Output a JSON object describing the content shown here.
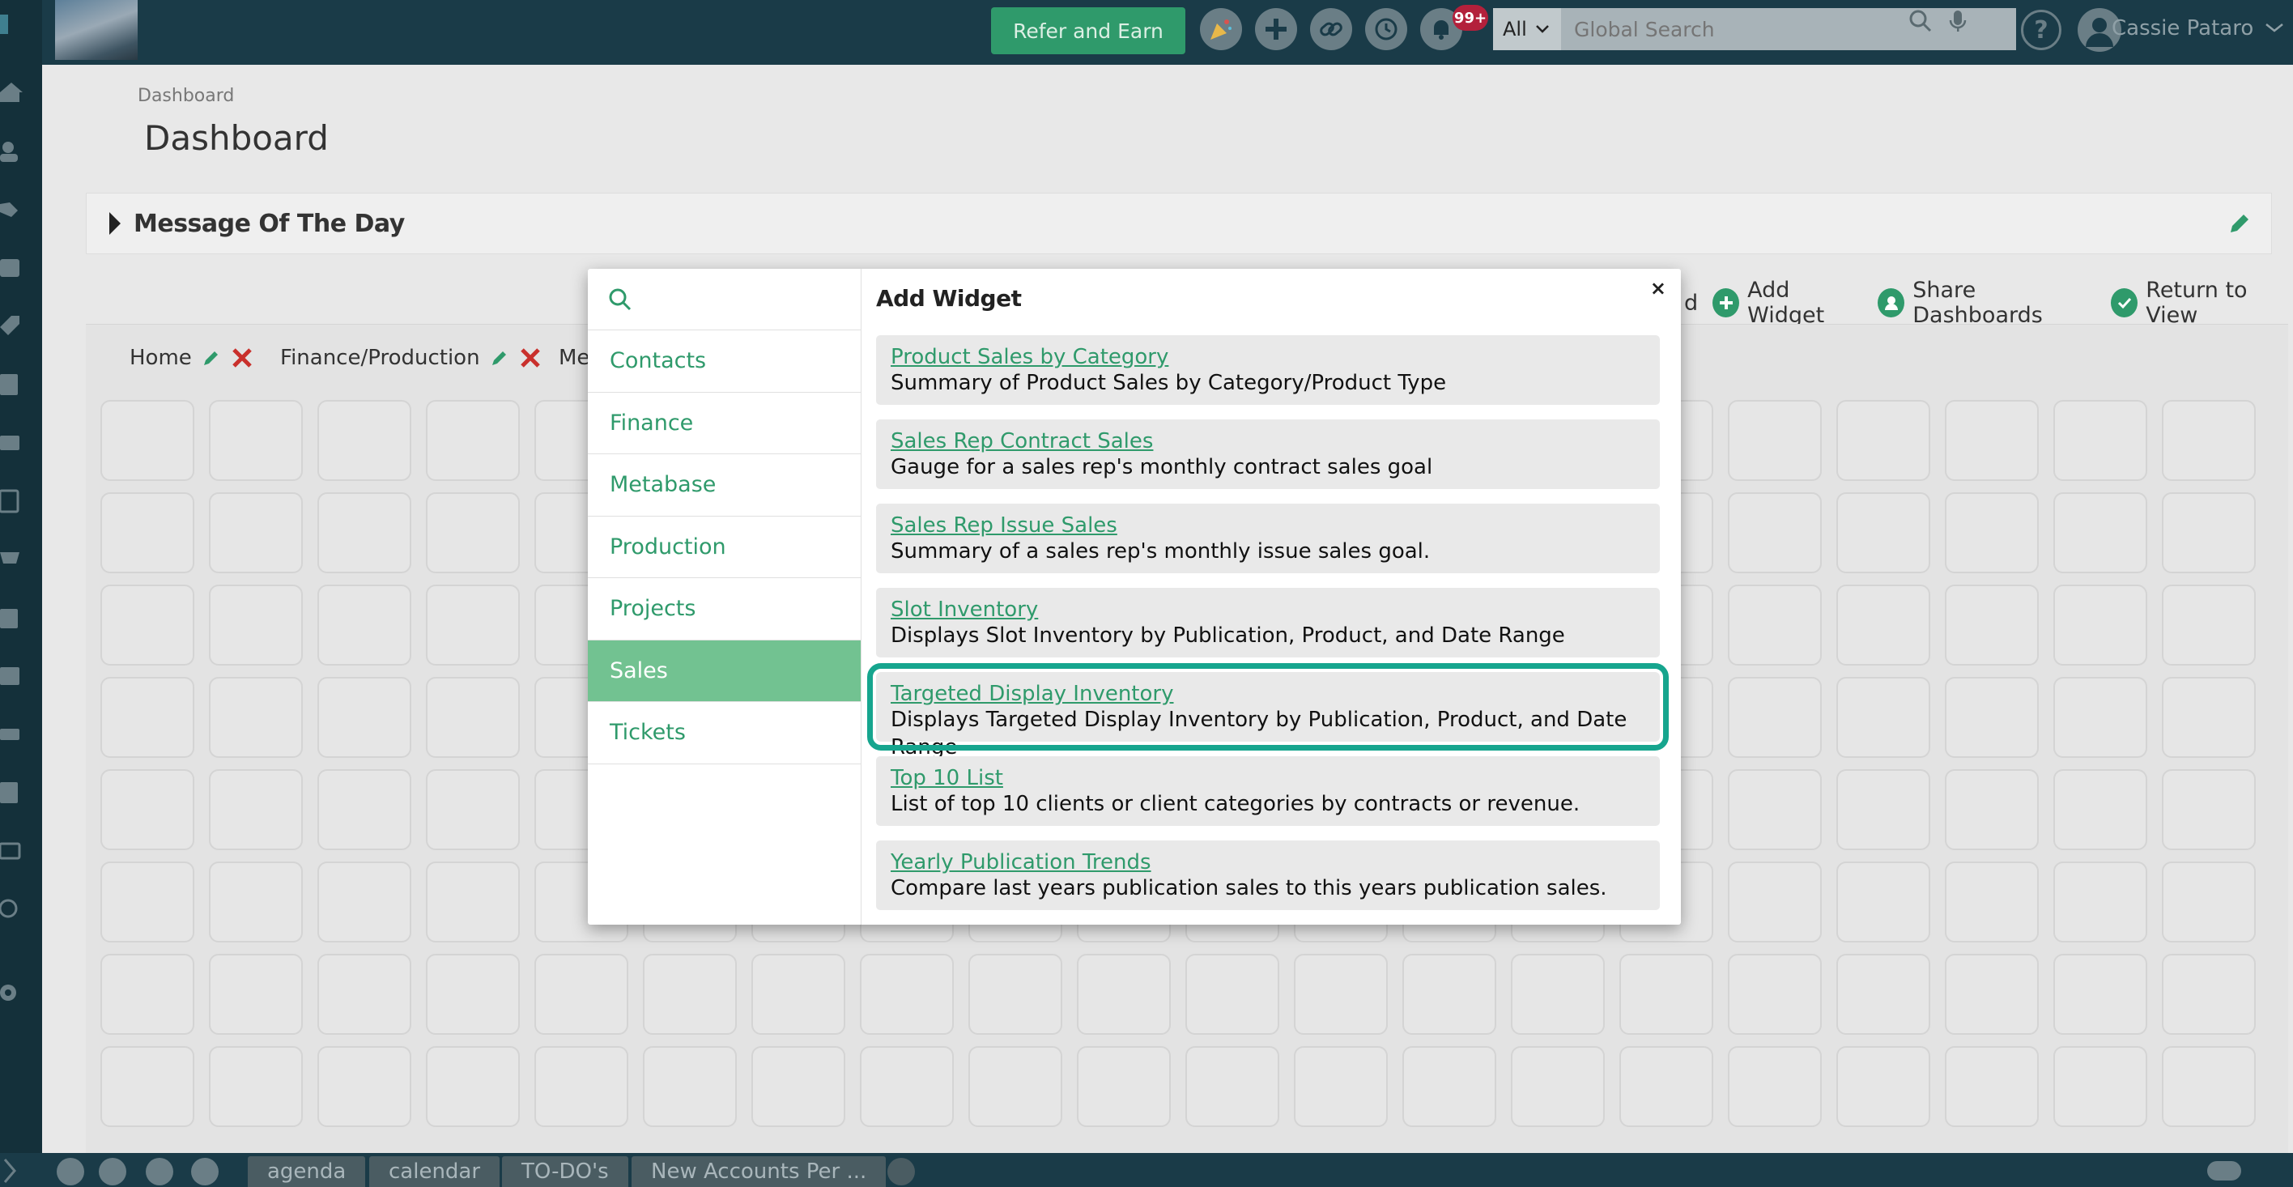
{
  "topbar": {
    "refer_label": "Refer and Earn",
    "notifications_badge": "99+",
    "search_scope": "All",
    "search_placeholder": "Global Search",
    "help_label": "?",
    "user_name": "Cassie Pataro"
  },
  "page": {
    "breadcrumb": "Dashboard",
    "title": "Dashboard",
    "motd_label": "Message Of The Day"
  },
  "dashboard_toolbar": {
    "partial_label": "d",
    "add_widget": "Add Widget",
    "share": "Share Dashboards",
    "return": "Return to View"
  },
  "tabs": [
    {
      "label": "Home"
    },
    {
      "label": "Finance/Production"
    },
    {
      "label": "Me"
    }
  ],
  "modal": {
    "title": "Add Widget",
    "close": "×",
    "search_value": "",
    "categories": [
      {
        "label": "Contacts"
      },
      {
        "label": "Finance"
      },
      {
        "label": "Metabase"
      },
      {
        "label": "Production"
      },
      {
        "label": "Projects"
      },
      {
        "label": "Sales"
      },
      {
        "label": "Tickets"
      }
    ],
    "active_category": "Sales",
    "widgets": [
      {
        "name": "Product Sales by Category",
        "desc": "Summary of Product Sales by Category/Product Type"
      },
      {
        "name": "Sales Rep Contract Sales",
        "desc": "Gauge for a sales rep's monthly contract sales goal"
      },
      {
        "name": "Sales Rep Issue Sales",
        "desc": "Summary of a sales rep's monthly issue sales goal."
      },
      {
        "name": "Slot Inventory",
        "desc": "Displays Slot Inventory by Publication, Product, and Date Range"
      },
      {
        "name": "Targeted Display Inventory",
        "desc": "Displays Targeted Display Inventory by Publication, Product, and Date Range"
      },
      {
        "name": "Top 10 List",
        "desc": "List of top 10 clients or client categories by contracts or revenue."
      },
      {
        "name": "Yearly Publication Trends",
        "desc": "Compare last years publication sales to this years publication sales."
      }
    ],
    "highlighted_widget": "Targeted Display Inventory"
  },
  "bottom_tabs": [
    {
      "label": "agenda"
    },
    {
      "label": "calendar"
    },
    {
      "label": "TO-DO's"
    },
    {
      "label": "New Accounts Per ..."
    }
  ],
  "colors": {
    "accent": "#2f9a6b",
    "active_category_bg": "#72c291",
    "highlight_outline": "#16a58e",
    "topbar": "#1a3b48"
  }
}
